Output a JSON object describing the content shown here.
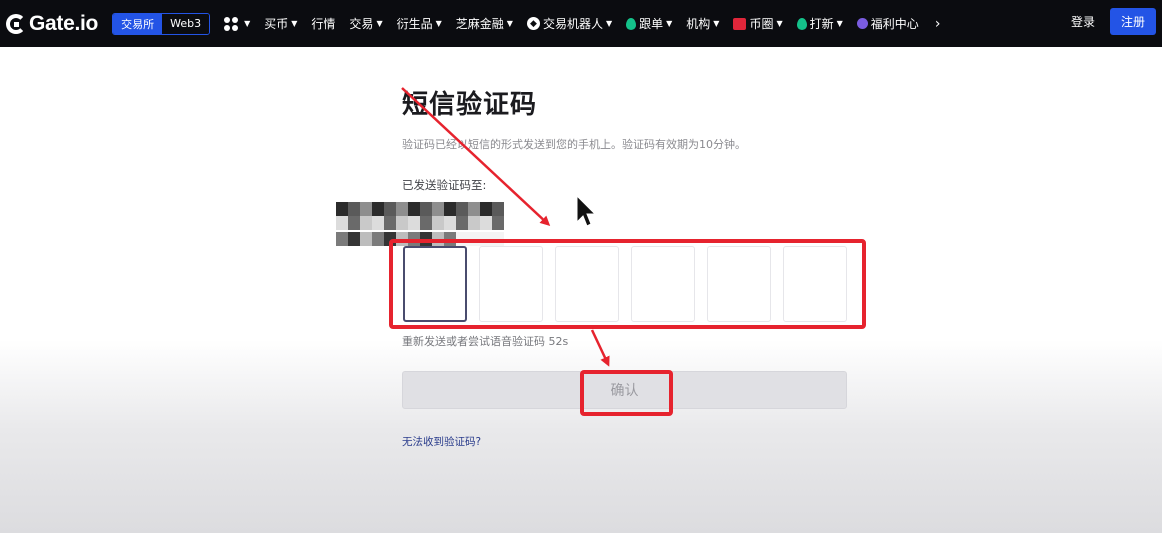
{
  "header": {
    "logo_text": "Gate.io",
    "mode_tabs": [
      "交易所",
      "Web3"
    ],
    "nav_items": [
      {
        "label": "",
        "icon": "apps-grid-icon",
        "caret": true
      },
      {
        "label": "买币",
        "icon": "",
        "caret": true
      },
      {
        "label": "行情",
        "icon": "",
        "caret": false
      },
      {
        "label": "交易",
        "icon": "",
        "caret": true
      },
      {
        "label": "衍生品",
        "icon": "",
        "caret": true
      },
      {
        "label": "芝麻金融",
        "icon": "",
        "caret": true
      },
      {
        "label": "交易机器人",
        "icon": "bot-icon",
        "caret": true
      },
      {
        "label": "跟单",
        "icon": "green-drop-icon",
        "caret": true
      },
      {
        "label": "机构",
        "icon": "",
        "caret": true
      },
      {
        "label": "币圈",
        "icon": "red-chart-icon",
        "caret": true
      },
      {
        "label": "打新",
        "icon": "green-drop-icon",
        "caret": true
      },
      {
        "label": "福利中心",
        "icon": "gift-icon",
        "caret": false
      }
    ],
    "more_icon": "chevron-right-icon",
    "login_label": "登录",
    "register_label": "注册"
  },
  "main": {
    "title": "短信验证码",
    "subtitle": "验证码已经以短信的形式发送到您的手机上。验证码有效期为10分钟。",
    "sent_to_label": "已发送验证码至:",
    "code_inputs": [
      "",
      "",
      "",
      "",
      "",
      ""
    ],
    "resend_text": "重新发送或者尝试语音验证码 52s",
    "confirm_label": "确认",
    "cant_receive_link": "无法收到验证码?"
  },
  "annotations": {
    "highlight_color": "#e6232e"
  },
  "colors": {
    "header_bg": "#0b0c10",
    "brand_blue": "#2354e6",
    "accent_green": "#14c28a"
  }
}
